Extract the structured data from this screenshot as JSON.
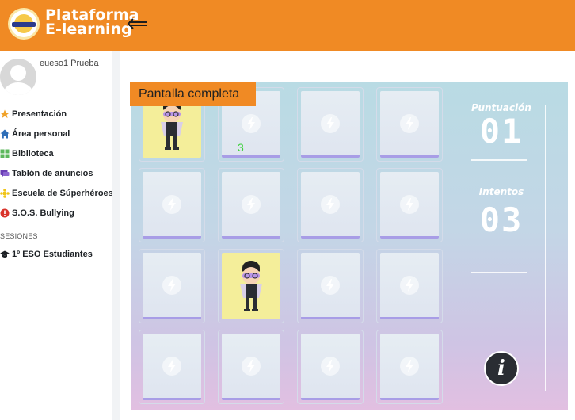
{
  "header": {
    "brand_line1": "Plataforma",
    "brand_line2": "E-learning",
    "menu_icon": "menu-arrow-icon"
  },
  "user": {
    "name": "eueso1 Prueba"
  },
  "sidebar": {
    "items": [
      {
        "label": "Presentación",
        "icon": "star-icon",
        "color": "#f0a229"
      },
      {
        "label": "Área personal",
        "icon": "home-icon",
        "color": "#2f6fb8"
      },
      {
        "label": "Biblioteca",
        "icon": "grid-icon",
        "color": "#5cb85c"
      },
      {
        "label": "Tablón de anuncios",
        "icon": "chat-icon",
        "color": "#6a3fb5"
      },
      {
        "label": "Escuela de Súperhéroes",
        "icon": "puzzle-icon",
        "color": "#f0c419"
      },
      {
        "label": "S.O.S. Bullying",
        "icon": "alert-icon",
        "color": "#d9342b"
      }
    ],
    "section_label": "SESIONES",
    "sessions": [
      {
        "label": "1º ESO Estudiantes",
        "icon": "graduation-cap-icon",
        "color": "#1d2125"
      }
    ]
  },
  "game": {
    "fullscreen_label": "Pantalla completa",
    "pair_indicator": "3",
    "score_label": "Puntuación",
    "score_value": "01",
    "attempts_label": "Intentos",
    "attempts_value": "03",
    "info_label": "i",
    "revealed_cards": [
      0,
      9
    ]
  },
  "colors": {
    "accent": "#f08a24",
    "revealed_card": "#f4ee9a"
  }
}
